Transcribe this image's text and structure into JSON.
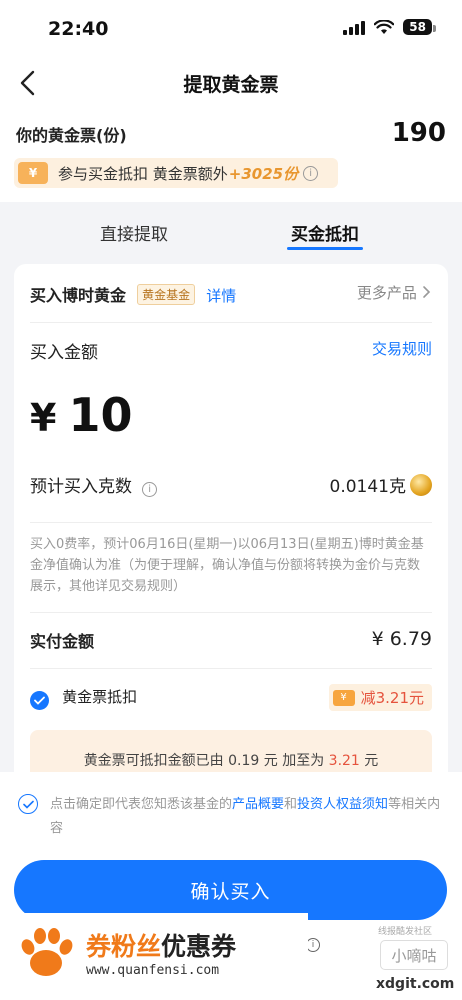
{
  "status_bar": {
    "time": "22:40",
    "battery": "58"
  },
  "nav": {
    "title": "提取黄金票"
  },
  "tickets": {
    "label": "你的黄金票(份)",
    "count": "190",
    "promo_text": "参与买金抵扣 黄金票额外",
    "promo_bonus": "+3025份",
    "ticket_icon_symbol": "¥"
  },
  "tabs": [
    {
      "label": "直接提取",
      "active": false
    },
    {
      "label": "买金抵扣",
      "active": true
    }
  ],
  "product": {
    "name": "买入博时黄金",
    "tag": "黄金基金",
    "details_link": "详情",
    "more_link": "更多产品"
  },
  "amount": {
    "label": "买入金额",
    "rules_link": "交易规则",
    "currency": "¥",
    "value": "10"
  },
  "grams": {
    "label": "预计买入克数",
    "value": "0.0141克"
  },
  "note": "买入0费率，预计06月16日(星期一)以06月13日(星期五)博时黄金基金净值确认为准（为便于理解，确认净值与份额将转换为金价与克数展示，其他详见交易规则）",
  "payment": {
    "label": "实付金额",
    "value": "¥ 6.79"
  },
  "deduction": {
    "label": "黄金票抵扣",
    "checked": true,
    "badge": "减3.21元",
    "badge_icon_symbol": "¥"
  },
  "tip": {
    "prefix": "黄金票可抵扣金额已由 ",
    "from": "0.19",
    "mid": " 元 加至为 ",
    "to": "3.21",
    "suffix": " 元"
  },
  "agreement": {
    "prefix": "点击确定即代表您知悉该基金的",
    "link1": "产品概要",
    "and": "和",
    "link2": "投资人权益须知",
    "suffix": "等相关内容"
  },
  "confirm_button": "确认买入",
  "watermark": {
    "title_orange": "券粉丝",
    "title_dark": "优惠券",
    "url": "www.quanfensi.com",
    "small_text": "线报酷发社区",
    "box_text": "小嘀咕",
    "domain": "xdgit.com"
  },
  "colors": {
    "accent": "#1677ff",
    "gold": "#e8962f",
    "discount_red": "#e5533d"
  }
}
